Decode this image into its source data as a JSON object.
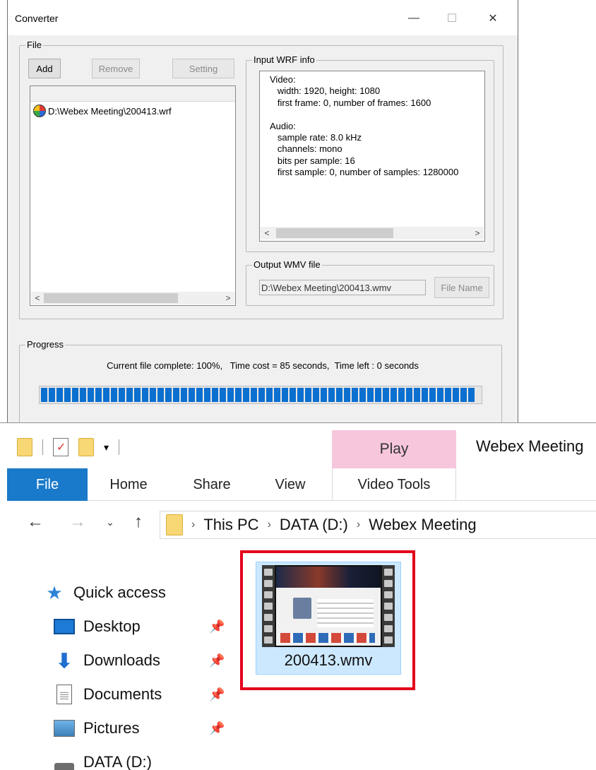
{
  "converter": {
    "title": "Converter",
    "controls": {
      "minimize": "—",
      "maximize": "☐",
      "close": "✕"
    },
    "file_group": {
      "label": "File",
      "add_label": "Add",
      "remove_label": "Remove",
      "setting_label": "Setting",
      "items": [
        {
          "path": "D:\\Webex Meeting\\200413.wrf",
          "icon": "wrf-file-icon"
        }
      ]
    },
    "wrf_info": {
      "label": "Input WRF info",
      "text": "Video:\n   width: 1920, height: 1080\n   first frame: 0, number of frames: 1600\n\nAudio:\n   sample rate: 8.0 kHz\n   channels: mono\n   bits per sample: 16\n   first sample: 0, number of samples: 1280000"
    },
    "output": {
      "label": "Output WMV file",
      "path": "D:\\Webex Meeting\\200413.wmv",
      "file_name_label": "File Name"
    },
    "progress": {
      "label": "Progress",
      "text": "Current file complete: 100%,   Time cost = 85 seconds,  Time left : 0 seconds",
      "percent": 100,
      "fill_color": "#0a6fcf"
    },
    "scroll_arrows": {
      "left": "<",
      "right": ">"
    }
  },
  "explorer": {
    "title": "Webex Meeting",
    "context_tab": "Play",
    "quick_access_dropdown": "▾",
    "ribbon_tabs": [
      "File",
      "Home",
      "Share",
      "View",
      "Video Tools"
    ],
    "nav": {
      "back": "←",
      "forward": "→",
      "recent": "⌄",
      "up": "↑"
    },
    "breadcrumb": [
      "This PC",
      "DATA (D:)",
      "Webex Meeting"
    ],
    "crumb_sep": "›",
    "nav_pane": [
      {
        "label": "Quick access",
        "icon": "star-icon"
      },
      {
        "label": "Desktop",
        "icon": "desktop-icon",
        "pinned": true
      },
      {
        "label": "Downloads",
        "icon": "download-arrow-icon",
        "pinned": true
      },
      {
        "label": "Documents",
        "icon": "document-icon",
        "pinned": true
      },
      {
        "label": "Pictures",
        "icon": "pictures-icon",
        "pinned": true
      },
      {
        "label": "DATA (D:)",
        "icon": "drive-icon"
      }
    ],
    "pin_glyph": "📌",
    "file": {
      "name": "200413.wmv",
      "selected": true,
      "highlight_color": "#e3001b"
    }
  }
}
